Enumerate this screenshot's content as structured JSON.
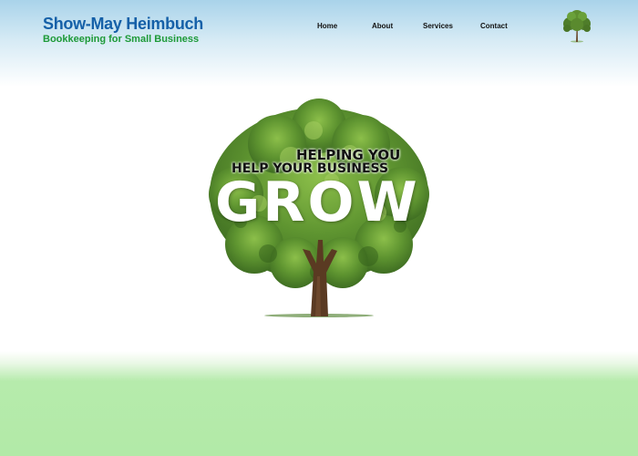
{
  "brand": {
    "name": "Show-May Heimbuch",
    "tagline": "Bookkeeping for Small Business"
  },
  "nav": {
    "items": [
      {
        "label": "Home"
      },
      {
        "label": "About"
      },
      {
        "label": "Services"
      },
      {
        "label": "Contact"
      }
    ]
  },
  "hero": {
    "line1": "HELPING YOU",
    "line2": "HELP YOUR BUSINESS",
    "big_word": "GROW"
  },
  "colors": {
    "brand_blue": "#1560a8",
    "brand_green": "#1d9a38",
    "sky": "#a9d3ea",
    "grass": "#b2eaa7"
  },
  "icons": {
    "logo": "tree-logo-icon",
    "hero": "tree-illustration"
  }
}
